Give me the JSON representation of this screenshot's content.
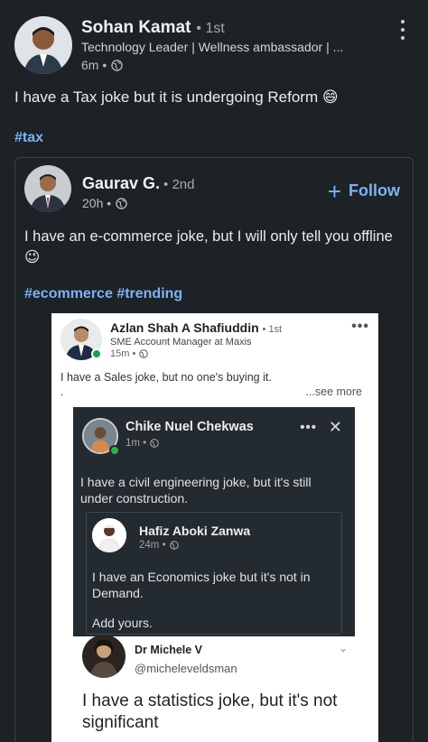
{
  "post": {
    "author": "Sohan Kamat",
    "degree": "• 1st",
    "headline": "Technology Leader | Wellness ambassador | ...",
    "time": "6m •",
    "text": "I have a Tax joke but it is undergoing Reform 😄",
    "hashtag": "#tax"
  },
  "shared": {
    "author": "Gaurav G.",
    "degree": "• 2nd",
    "time": "20h •",
    "follow_label": "Follow",
    "text": "I have an e-commerce joke, but I will only tell you offline 😉",
    "hashtags": "#ecommerce #trending"
  },
  "image": {
    "author": "Azlan Shah A Shafiuddin",
    "degree": "• 1st",
    "headline": "SME Account Manager at Maxis",
    "time": "15m •",
    "text": "I have a Sales joke, but no one's buying it.",
    "dot": ".",
    "see_more": "...see more",
    "nested": {
      "author": "Chike Nuel Chekwas",
      "time": "1m •",
      "text": "I have a civil engineering joke, but it's still under construction.",
      "inner": {
        "author": "Hafiz Aboki Zanwa",
        "time": "24m •",
        "text": "I have an Economics joke but it's not in Demand.",
        "add": "Add yours."
      }
    },
    "tweet": {
      "author": "Dr Michele V",
      "handle": "@micheleveldsman",
      "text": "I have a statistics joke, but it's not significant"
    }
  },
  "colors": {
    "background": "#1d2226",
    "link": "#7ab5f5",
    "online": "#13a155"
  }
}
